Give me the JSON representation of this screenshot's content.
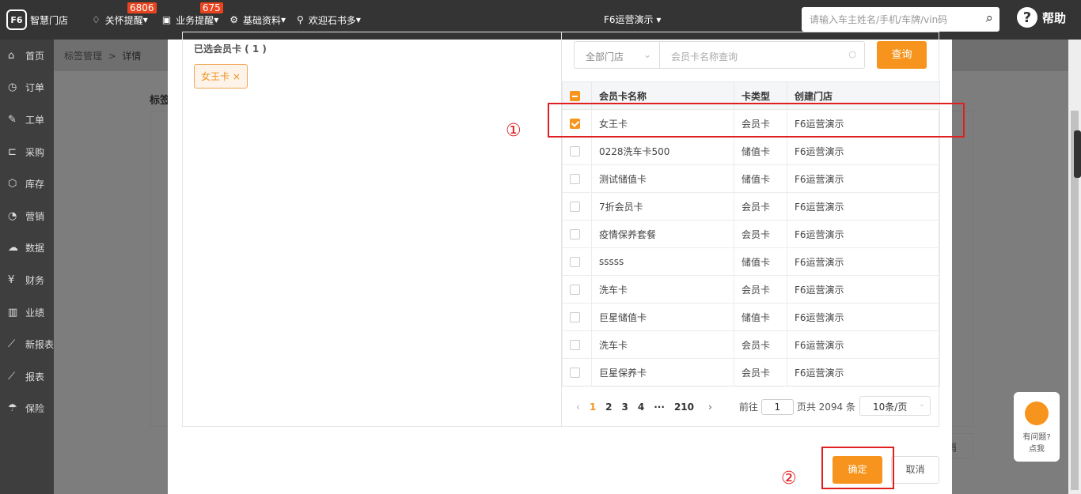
{
  "topbar": {
    "logo_mark": "F6",
    "logo_text": "智慧门店",
    "nav": [
      {
        "label": "关怀提醒",
        "badge": "6806",
        "icon": "bell-icon"
      },
      {
        "label": "业务提醒",
        "badge": "675",
        "icon": "document-icon"
      },
      {
        "label": "基础资料",
        "icon": "gear-icon"
      },
      {
        "label": "欢迎石书多",
        "icon": "user-icon"
      }
    ],
    "store": "F6运营演示",
    "search_placeholder": "请输入车主姓名/手机/车牌/vin码",
    "help": "帮助"
  },
  "sidebar": {
    "items": [
      {
        "label": "首页",
        "icon": "home-icon"
      },
      {
        "label": "订单",
        "icon": "clock-icon"
      },
      {
        "label": "工单",
        "icon": "wrench-icon"
      },
      {
        "label": "采购",
        "icon": "cart-icon"
      },
      {
        "label": "库存",
        "icon": "box-icon"
      },
      {
        "label": "营销",
        "icon": "pie-icon"
      },
      {
        "label": "数据",
        "icon": "cloud-icon"
      },
      {
        "label": "财务",
        "icon": "yen-icon"
      },
      {
        "label": "业绩",
        "icon": "bar-chart-icon"
      },
      {
        "label": "新报表",
        "icon": "line-chart-icon"
      },
      {
        "label": "报表",
        "icon": "line-chart-icon"
      },
      {
        "label": "保险",
        "icon": "umbrella-icon"
      }
    ]
  },
  "background": {
    "breadcrumb": [
      "标签管理",
      "详情"
    ],
    "label": "标签",
    "cancel": "消"
  },
  "modal": {
    "selected_title": "已选会员卡 ( 1 )",
    "selected_tags": [
      "女王卡"
    ],
    "store_filter": "全部门店",
    "card_search_placeholder": "会员卡名称查询",
    "query": "查询",
    "columns": [
      "会员卡名称",
      "卡类型",
      "创建门店"
    ],
    "rows": [
      {
        "name": "女王卡",
        "type": "会员卡",
        "store": "F6运营演示",
        "checked": true
      },
      {
        "name": "0228洗车卡500",
        "type": "储值卡",
        "store": "F6运营演示",
        "checked": false
      },
      {
        "name": "测试储值卡",
        "type": "储值卡",
        "store": "F6运营演示",
        "checked": false
      },
      {
        "name": "7折会员卡",
        "type": "会员卡",
        "store": "F6运营演示",
        "checked": false
      },
      {
        "name": "疫情保养套餐",
        "type": "会员卡",
        "store": "F6运营演示",
        "checked": false
      },
      {
        "name": "sssss",
        "type": "储值卡",
        "store": "F6运营演示",
        "checked": false
      },
      {
        "name": "洗车卡",
        "type": "会员卡",
        "store": "F6运营演示",
        "checked": false
      },
      {
        "name": "巨星储值卡",
        "type": "储值卡",
        "store": "F6运营演示",
        "checked": false
      },
      {
        "name": "洗车卡",
        "type": "会员卡",
        "store": "F6运营演示",
        "checked": false
      },
      {
        "name": "巨星保养卡",
        "type": "会员卡",
        "store": "F6运营演示",
        "checked": false
      }
    ],
    "pager": {
      "pages": [
        "1",
        "2",
        "3",
        "4",
        "···",
        "210"
      ],
      "current": "1",
      "goto_label": "前往",
      "goto_value": "1",
      "total": "页共 2094 条",
      "page_size": "10条/页"
    },
    "ok": "确定",
    "cancel": "取消"
  },
  "annotations": {
    "step1": "①",
    "step2": "②"
  },
  "widget": {
    "line1": "有问题?",
    "line2": "点我"
  },
  "colors": {
    "accent": "#f7941d",
    "annotation": "#e02020",
    "badge": "#e8441f"
  }
}
